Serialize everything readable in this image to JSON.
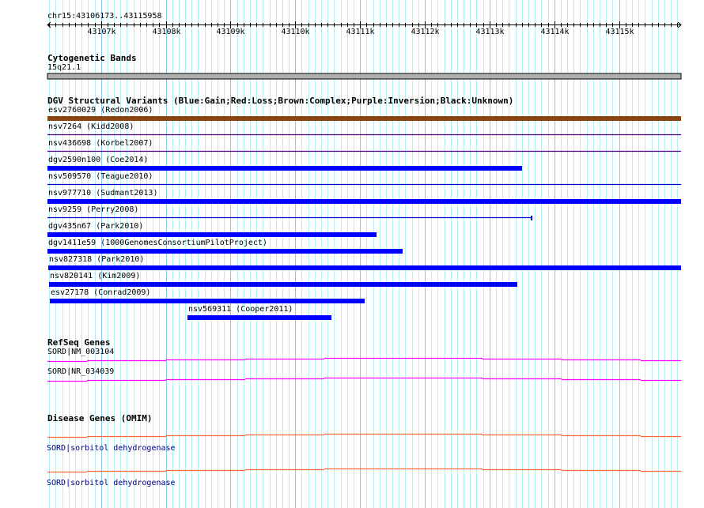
{
  "ruler": {
    "label": "chr15:43106173..43115958",
    "start": 43106173,
    "end": 43115958,
    "tick_labels": [
      "43107k",
      "43108k",
      "43109k",
      "43110k",
      "43111k",
      "43112k",
      "43113k",
      "43114k",
      "43115k"
    ]
  },
  "cytoband": {
    "title": "Cytogenetic Bands",
    "band": "15q21.1",
    "color": "#b0b0b0"
  },
  "dgv": {
    "title": "DGV Structural Variants (Blue:Gain;Red:Loss;Brown:Complex;Purple:Inversion;Black:Unknown)",
    "variants": [
      {
        "label": "esv2760029 (Redon2006)",
        "type": "Complex",
        "glyph": "bar",
        "start": 43106173,
        "end": 43115958,
        "color": "#8b4513"
      },
      {
        "label": "nsv7264 (Kidd2008)",
        "type": "Inversion",
        "glyph": "line",
        "start": 43106173,
        "end": 43115958,
        "color": "#4b0082"
      },
      {
        "label": "nsv436698 (Korbel2007)",
        "type": "Inversion",
        "glyph": "line",
        "start": 43106173,
        "end": 43115958,
        "color": "#4b0082"
      },
      {
        "label": "dgv2590n100 (Coe2014)",
        "type": "Gain",
        "glyph": "bar",
        "start": 43106173,
        "end": 43113503,
        "color": "#0000ff"
      },
      {
        "label": "nsv509570 (Teague2010)",
        "type": "Gain",
        "glyph": "line",
        "start": 43106173,
        "end": 43115958,
        "color": "#0000cc"
      },
      {
        "label": "nsv977710 (Sudmant2013)",
        "type": "Gain",
        "glyph": "bar",
        "start": 43106173,
        "end": 43115958,
        "color": "#0000ff"
      },
      {
        "label": "nsv9259 (Perry2008)",
        "type": "Gain",
        "glyph": "line-end",
        "start": 43106173,
        "end": 43113649,
        "color": "#0000cc"
      },
      {
        "label": "dgv435n67 (Park2010)",
        "type": "Gain",
        "glyph": "bar",
        "start": 43106173,
        "end": 43111255,
        "color": "#0000ff"
      },
      {
        "label": "dgv1411e59 (1000GenomesConsortiumPilotProject)",
        "type": "Gain",
        "glyph": "bar",
        "start": 43106173,
        "end": 43111658,
        "color": "#0000ff"
      },
      {
        "label": "nsv827318 (Park2010)",
        "type": "Gain",
        "glyph": "bar",
        "start": 43106185,
        "end": 43115958,
        "color": "#0000ff"
      },
      {
        "label": "nsv820141 (Kim2009)",
        "type": "Gain",
        "glyph": "bar",
        "start": 43106197,
        "end": 43113429,
        "color": "#0000ff"
      },
      {
        "label": "esv27178 (Conrad2009)",
        "type": "Gain",
        "glyph": "bar",
        "start": 43106210,
        "end": 43111072,
        "color": "#0000ff"
      },
      {
        "label": "nsv569311 (Cooper2011)",
        "type": "Gain",
        "glyph": "bar",
        "start": 43108335,
        "end": 43110559,
        "color": "#0000ff"
      }
    ]
  },
  "refseq": {
    "title": "RefSeq Genes",
    "color": "#ff00ff",
    "genes": [
      {
        "label": "SORD|NM_003104"
      },
      {
        "label": "SORD|NR_034039"
      }
    ]
  },
  "omim": {
    "title": "Disease Genes (OMIM)",
    "color": "#ff6633",
    "genes": [
      {
        "label": "SORD|sorbitol dehydrogenase"
      },
      {
        "label": "SORD|sorbitol dehydrogenase"
      }
    ]
  }
}
